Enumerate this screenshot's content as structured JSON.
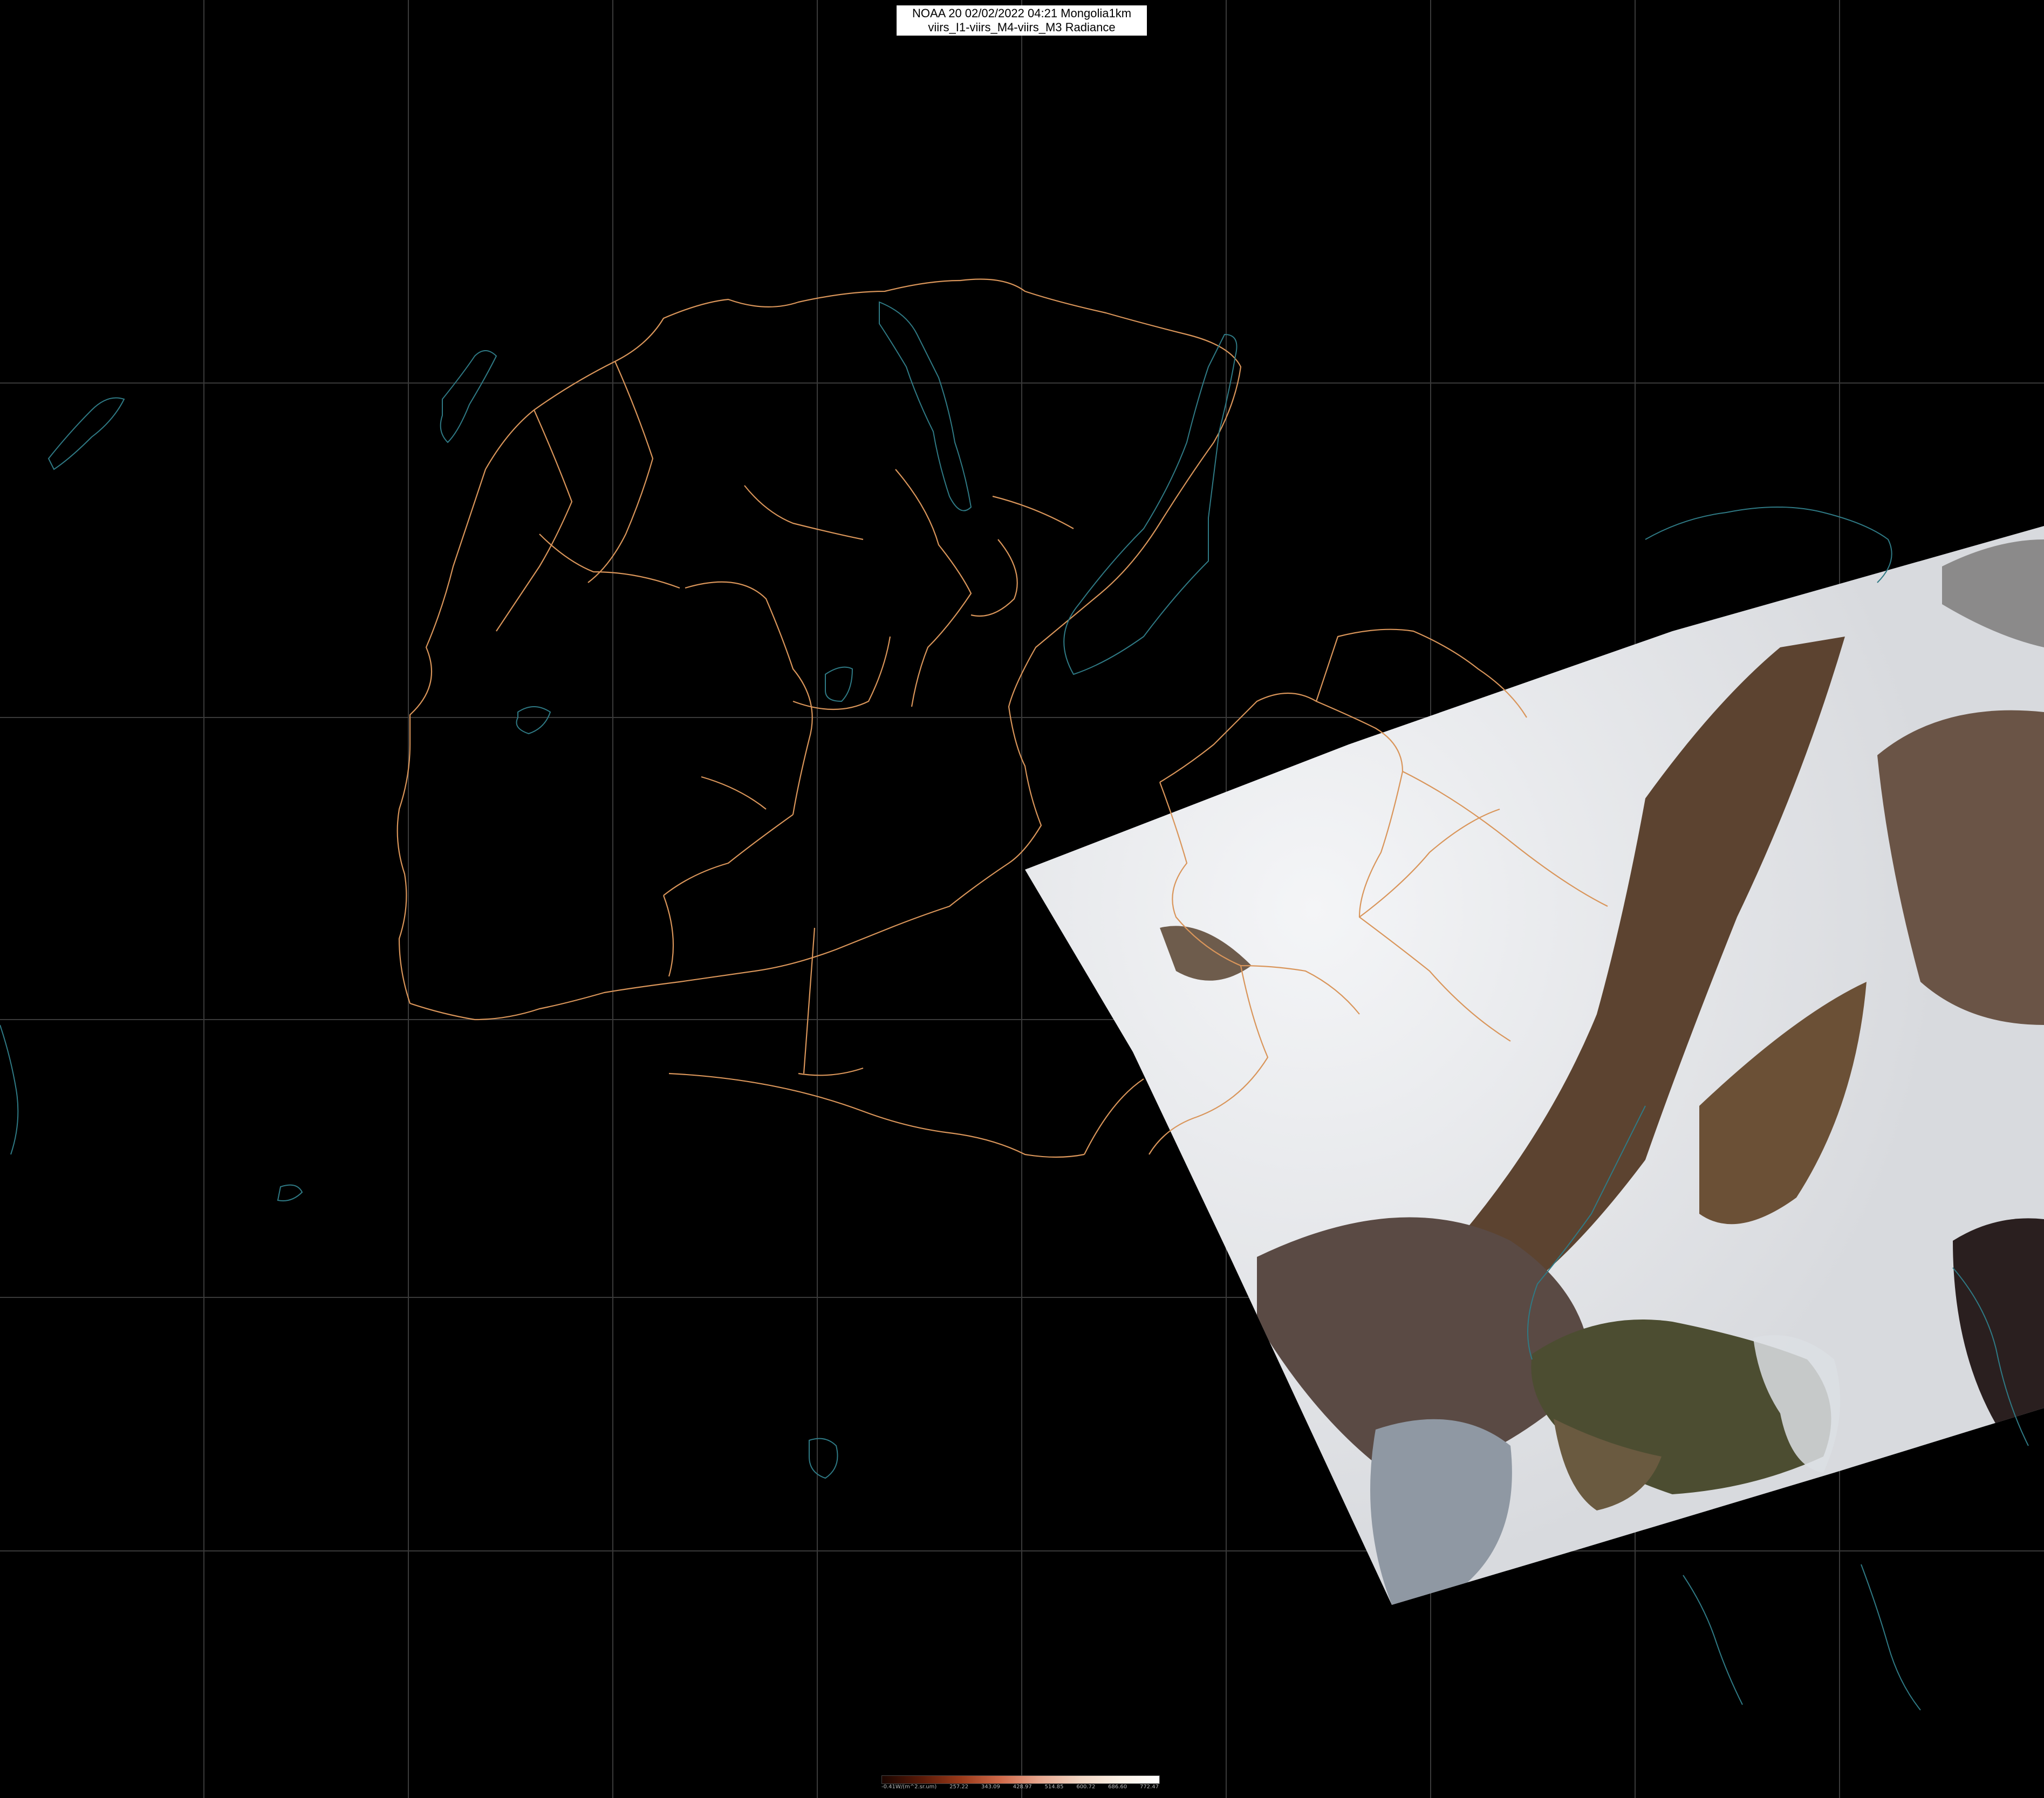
{
  "title": {
    "line1": "NOAA 20 02/02/2022 04:21 Mongolia1km",
    "line2": "viirs_I1-viirs_M4-viirs_M3 Radiance"
  },
  "colorbar": {
    "labels": [
      "-0.41W/(m^2.sr.um)",
      "257.22",
      "343.09",
      "428.97",
      "514.85",
      "600.72",
      "686.60",
      "772.47"
    ]
  },
  "colors": {
    "background": "#000000",
    "graticule": "#3a3a3a",
    "province_border": "#d9955a",
    "coastline": "#2f7a85",
    "snow": "#eceef2",
    "bare_ground": "#5f4632",
    "sea": "#4a4a2e"
  }
}
